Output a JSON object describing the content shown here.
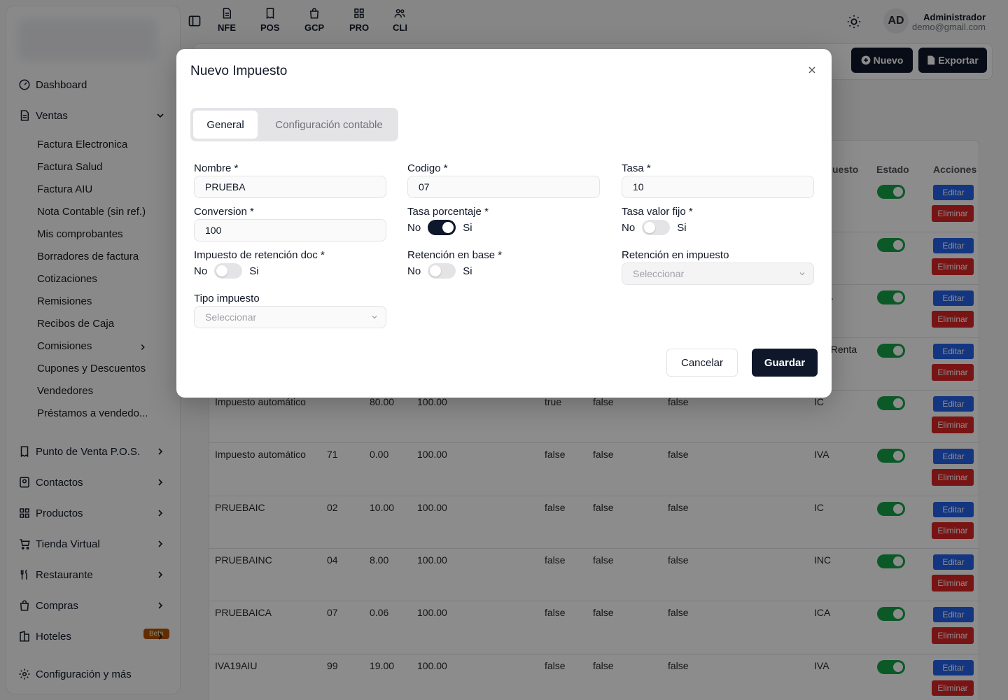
{
  "topbar": {
    "apps": [
      {
        "label": "NFE",
        "icon": "document-icon"
      },
      {
        "label": "POS",
        "icon": "receipt-icon"
      },
      {
        "label": "GCP",
        "icon": "bag-icon"
      },
      {
        "label": "PRO",
        "icon": "grid-icon"
      },
      {
        "label": "CLI",
        "icon": "users-icon"
      }
    ],
    "user": {
      "initials": "AD",
      "name": "Administrador",
      "email": "demo@gmail.com"
    }
  },
  "sidebar": {
    "items": [
      {
        "label": "Dashboard"
      },
      {
        "label": "Ventas"
      },
      {
        "label": "Punto de Venta P.O.S."
      },
      {
        "label": "Contactos"
      },
      {
        "label": "Productos"
      },
      {
        "label": "Tienda Virtual"
      },
      {
        "label": "Restaurante"
      },
      {
        "label": "Compras"
      },
      {
        "label": "Hoteles",
        "badge": "Beta"
      },
      {
        "label": "Configuración y más"
      }
    ],
    "ventas_sub": [
      "Factura Electronica",
      "Factura Salud",
      "Factura AIU",
      "Nota Contable (sin ref.)",
      "Mis comprobantes",
      "Borradores de factura",
      "Cotizaciones",
      "Remisiones",
      "Recibos de Caja",
      "Comisiones",
      "Cupones y Descuentos",
      "Vendedores",
      "Préstamos a vendedo..."
    ]
  },
  "header": {
    "new_label": "Nuevo",
    "export_label": "Exportar"
  },
  "table": {
    "headers": {
      "tipo_partial": "uesto",
      "estado": "Estado",
      "acciones": "Acciones"
    },
    "edit_label": "Editar",
    "delete_label": "Eliminar",
    "partial_rows": [
      {
        "tipo": ""
      },
      {
        "tipo": ""
      },
      {
        "tipo": "."
      },
      {
        "tipo": "eRenta"
      }
    ],
    "rows": [
      {
        "nombre": "Impuesto automático",
        "codigo": "",
        "tasa": "80.00",
        "conversion": "100.00",
        "c1": "true",
        "c2": "false",
        "c3": "false",
        "tipo": "IC"
      },
      {
        "nombre": "Impuesto automático",
        "codigo": "71",
        "tasa": "0.00",
        "conversion": "100.00",
        "c1": "false",
        "c2": "false",
        "c3": "false",
        "tipo": "IVA"
      },
      {
        "nombre": "PRUEBAIC",
        "codigo": "02",
        "tasa": "10.00",
        "conversion": "100.00",
        "c1": "false",
        "c2": "false",
        "c3": "false",
        "tipo": "IC"
      },
      {
        "nombre": "PRUEBAINC",
        "codigo": "04",
        "tasa": "8.00",
        "conversion": "100.00",
        "c1": "false",
        "c2": "false",
        "c3": "false",
        "tipo": "INC"
      },
      {
        "nombre": "PRUEBAICA",
        "codigo": "07",
        "tasa": "0.06",
        "conversion": "100.00",
        "c1": "false",
        "c2": "false",
        "c3": "false",
        "tipo": "ICA"
      },
      {
        "nombre": "IVA19AIU",
        "codigo": "99",
        "tasa": "19.00",
        "conversion": "100.00",
        "c1": "false",
        "c2": "false",
        "c3": "false",
        "tipo": "IVA"
      }
    ]
  },
  "modal": {
    "title": "Nuevo Impuesto",
    "tabs": {
      "general": "General",
      "contable": "Configuración contable"
    },
    "fields": {
      "nombre": {
        "label": "Nombre *",
        "value": "PRUEBA"
      },
      "codigo": {
        "label": "Codigo *",
        "value": "07"
      },
      "tasa": {
        "label": "Tasa *",
        "value": "10"
      },
      "conversion": {
        "label": "Conversion *",
        "value": "100"
      },
      "tasa_porcentaje": {
        "label": "Tasa porcentaje *",
        "value": true
      },
      "tasa_valor_fijo": {
        "label": "Tasa valor fijo *",
        "value": false
      },
      "impuesto_retencion_doc": {
        "label": "Impuesto de retención doc *",
        "value": false
      },
      "retencion_base": {
        "label": "Retención en base *",
        "value": false
      },
      "retencion_impuesto": {
        "label": "Retención en impuesto",
        "placeholder": "Seleccionar"
      },
      "tipo_impuesto": {
        "label": "Tipo impuesto",
        "placeholder": "Seleccionar"
      }
    },
    "switch_no": "No",
    "switch_si": "Si",
    "cancel_label": "Cancelar",
    "save_label": "Guardar"
  }
}
